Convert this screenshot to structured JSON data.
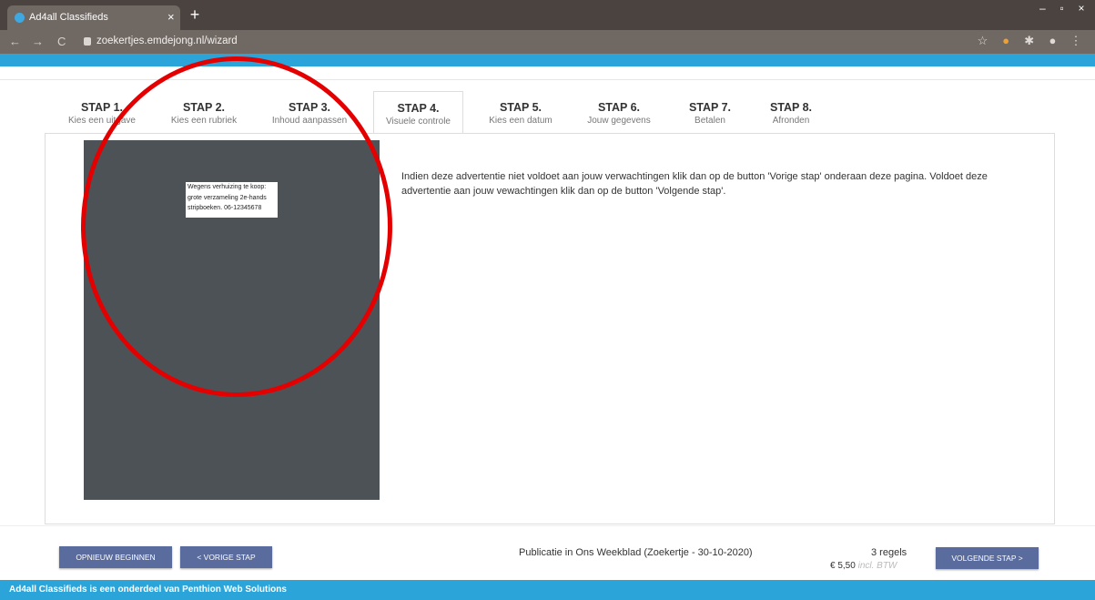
{
  "browser": {
    "tab_title": "Ad4all Classifieds",
    "tab_close": "×",
    "new_tab": "+",
    "url": "zoekertjes.emdejong.nl/wizard",
    "back": "←",
    "forward": "→",
    "reload": "C",
    "window_controls": [
      "–",
      "▫",
      "×"
    ],
    "toolbar_icons": [
      "☆",
      "●",
      "✱",
      "●",
      "⋮"
    ]
  },
  "steps": [
    {
      "title": "STAP 1.",
      "subtitle": "Kies een uitgave"
    },
    {
      "title": "STAP 2.",
      "subtitle": "Kies een rubriek"
    },
    {
      "title": "STAP 3.",
      "subtitle": "Inhoud aanpassen"
    },
    {
      "title": "STAP 4.",
      "subtitle": "Visuele controle"
    },
    {
      "title": "STAP 5.",
      "subtitle": "Kies een datum"
    },
    {
      "title": "STAP 6.",
      "subtitle": "Jouw gegevens"
    },
    {
      "title": "STAP 7.",
      "subtitle": "Betalen"
    },
    {
      "title": "STAP 8.",
      "subtitle": "Afronden"
    }
  ],
  "active_step": 4,
  "ad_preview": {
    "lines": [
      "Wegens verhuizing te koop:",
      "grote verzameling 2e-hands",
      "stripboeken. 06-12345678"
    ]
  },
  "info_text": "Indien deze advertentie niet voldoet aan jouw verwachtingen klik dan op de button 'Vorige stap' onderaan deze pagina. Voldoet deze advertentie aan jouw vewachtingen klik dan op de button 'Volgende stap'.",
  "footer": {
    "restart_label": "OPNIEUW BEGINNEN",
    "prev_label": "< VORIGE STAP",
    "next_label": "VOLGENDE STAP >",
    "publication": "Publicatie in Ons Weekblad (Zoekertje - 30-10-2020)",
    "regels": "3 regels",
    "price": "€ 5,50",
    "price_note": "incl. BTW"
  },
  "bottom_bar": "Ad4all Classifieds is een onderdeel van Penthion Web Solutions",
  "colors": {
    "accent_blue": "#2aa4d9",
    "button_blue": "#5a6b9e",
    "annotation_red": "#e40000",
    "preview_bg": "#4d5256"
  }
}
